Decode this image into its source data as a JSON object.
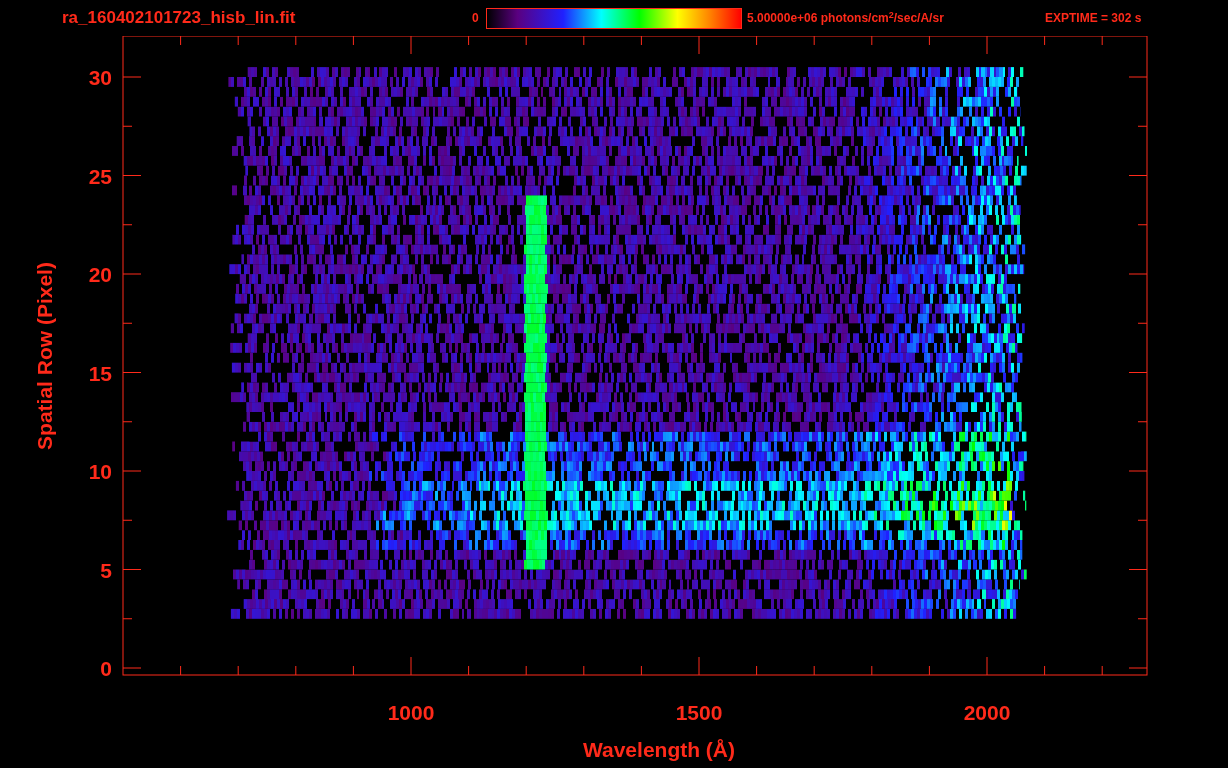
{
  "title": "ra_160402101723_hisb_lin.fit",
  "colorbar": {
    "min_label": "0",
    "max_label": "5.00000e+06 photons/cm$^{2}$/sec/A/sr"
  },
  "exptime": "EXPTIME = 302 s",
  "plot": {
    "xlabel": "Wavelength (Å)",
    "ylabel": "Spatial Row (Pixel)",
    "xtick_labels": [
      "1000",
      "1500",
      "2000"
    ],
    "ytick_labels": [
      "30",
      "25",
      "20",
      "15",
      "10",
      "5",
      "0"
    ]
  }
}
